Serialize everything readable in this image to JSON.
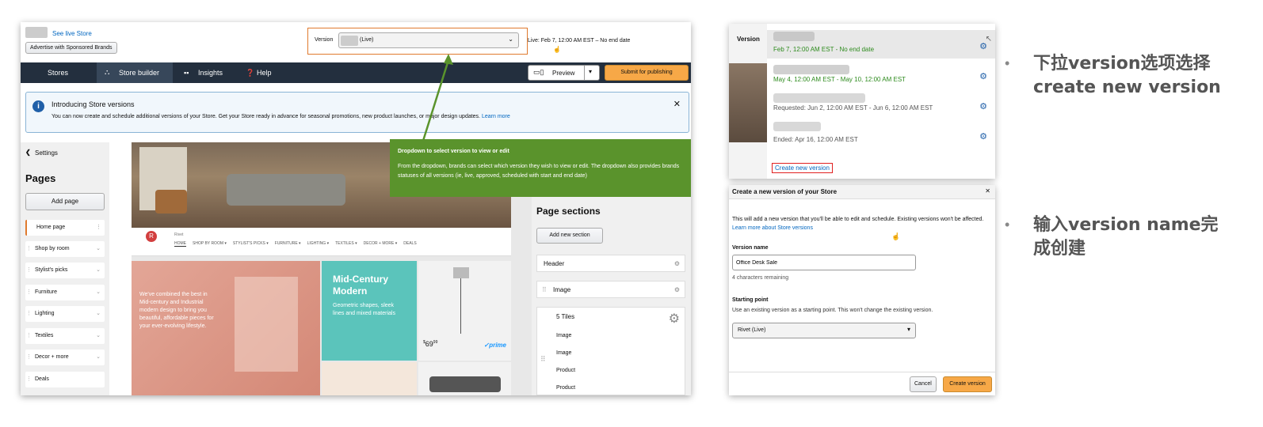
{
  "main": {
    "see_live_store": "See live Store",
    "advertise_button": "Advertise with Sponsored Brands",
    "version_label": "Version",
    "version_value": "(Live)",
    "live_text": "Live: Feb 7, 12:00 AM EST – No end date",
    "nav": {
      "stores": "Stores",
      "store_builder": "Store builder",
      "insights": "Insights",
      "help": "Help",
      "preview": "Preview",
      "submit": "Submit for publishing"
    },
    "banner": {
      "title": "Introducing Store versions",
      "body": "You can now create and schedule additional versions of your Store. Get your Store ready in advance for seasonal promotions, new product launches, or major design updates.",
      "learn_more": "Learn more"
    },
    "left": {
      "settings": "Settings",
      "pages_title": "Pages",
      "add_page": "Add page",
      "pages": [
        "Home page",
        "Shop by room",
        "Stylist's picks",
        "Furniture",
        "Lighting",
        "Textiles",
        "Decor + more",
        "Deals"
      ]
    },
    "canvas": {
      "brand_letter": "R",
      "brand_name": "Rivet",
      "menu": [
        "HOME",
        "SHOP BY ROOM ▾",
        "STYLIST'S PICKS ▾",
        "FURNITURE ▾",
        "LIGHTING ▾",
        "TEXTILES ▾",
        "DECOR + MORE ▾",
        "DEALS"
      ],
      "hero_text": "We've combined the best in Mid-century and Industrial modern design to bring you beautiful, affordable pieces for your ever-evolving lifestyle.",
      "mcm_title": "Mid-Century Modern",
      "mcm_sub": "Geometric shapes, sleek lines and mixed materials",
      "price_dollars": "69",
      "price_cents": "99",
      "prime": "✓prime"
    },
    "tooltip": {
      "title": "Dropdown to select version to view or edit",
      "body": "From the dropdown, brands can select which version they wish to view or edit. The dropdown also provides brands statuses of all versions (ie, live, approved, scheduled with start and end date)"
    },
    "right": {
      "title": "Page sections",
      "add_section": "Add new section",
      "sections": [
        "Header",
        "Image",
        "5 Tiles"
      ],
      "subitems": [
        "Image",
        "Image",
        "Product",
        "Product"
      ]
    }
  },
  "dropdown": {
    "label": "Version",
    "items": [
      {
        "date": "Feb 7, 12:00 AM EST - No end date",
        "color": "#2e8b1e"
      },
      {
        "date": "May 4, 12:00 AM EST - May 10, 12:00 AM EST",
        "color": "#2e8b1e"
      },
      {
        "date": "Requested: Jun 2, 12:00 AM EST - Jun 6, 12:00 AM EST",
        "color": "#555555"
      },
      {
        "date": "Ended: Apr 16, 12:00 AM EST",
        "color": "#555555"
      }
    ],
    "create_link": "Create new version"
  },
  "modal": {
    "title": "Create a new version of your Store",
    "intro": "This will add a new version that you'll be able to edit and schedule. Existing versions won't be affected.",
    "learn_link": "Learn more about Store versions",
    "name_label": "Version name",
    "name_value": "Office Desk Sale",
    "remaining": "4 characters remaining",
    "start_label": "Starting point",
    "start_help": "Use an existing version as a starting point. This won't change the existing version.",
    "start_value": "Rivet (Live)",
    "cancel": "Cancel",
    "create": "Create version"
  },
  "notes": {
    "bullet1": "下拉version选项选择create new version",
    "bullet2": "输入version name完成创建"
  }
}
